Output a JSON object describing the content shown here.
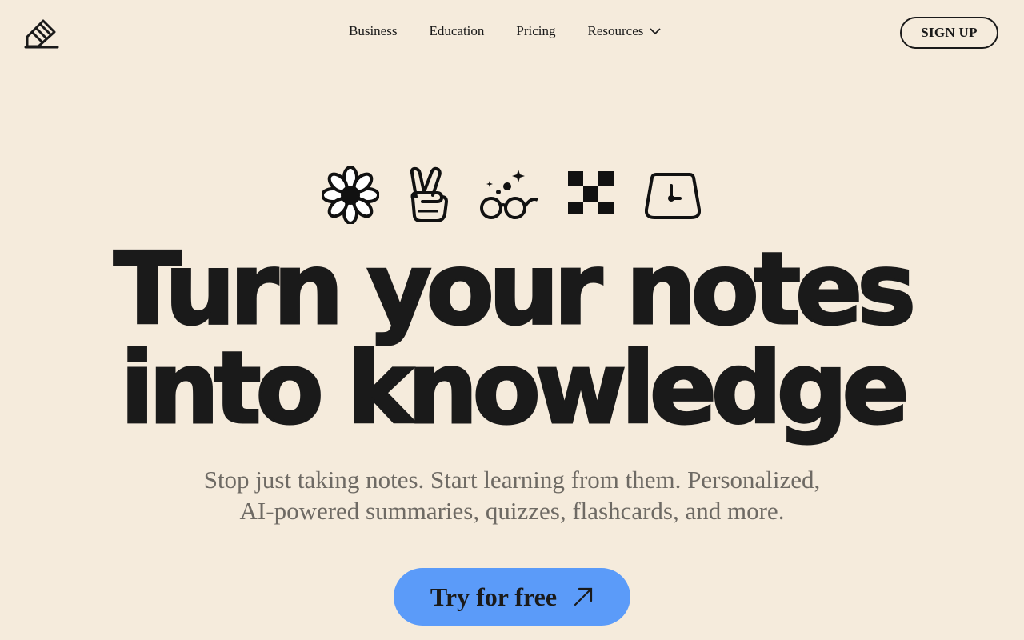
{
  "nav": {
    "logo_icon": "pencil-book-logo",
    "links": [
      {
        "label": "Business"
      },
      {
        "label": "Education"
      },
      {
        "label": "Pricing"
      },
      {
        "label": "Resources",
        "icon": "chevron-down-icon"
      }
    ],
    "signup_label": "SIGN UP"
  },
  "hero": {
    "icons": [
      "flower-icon",
      "peace-hand-icon",
      "sparkle-glasses-icon",
      "checkerboard-icon",
      "clock-icon"
    ],
    "headline_line1": "Turn your notes",
    "headline_line2": "into knowledge",
    "subtitle_line1": "Stop just taking notes. Start learning from them. Personalized,",
    "subtitle_line2": "AI-powered summaries, quizzes, flashcards, and more.",
    "cta_label": "Try for free",
    "cta_icon": "arrow-up-right-icon"
  },
  "colors": {
    "background": "#f5ebdc",
    "text": "#1a1a1a",
    "subtitle": "#6e6a64",
    "cta": "#5b9bf9"
  }
}
